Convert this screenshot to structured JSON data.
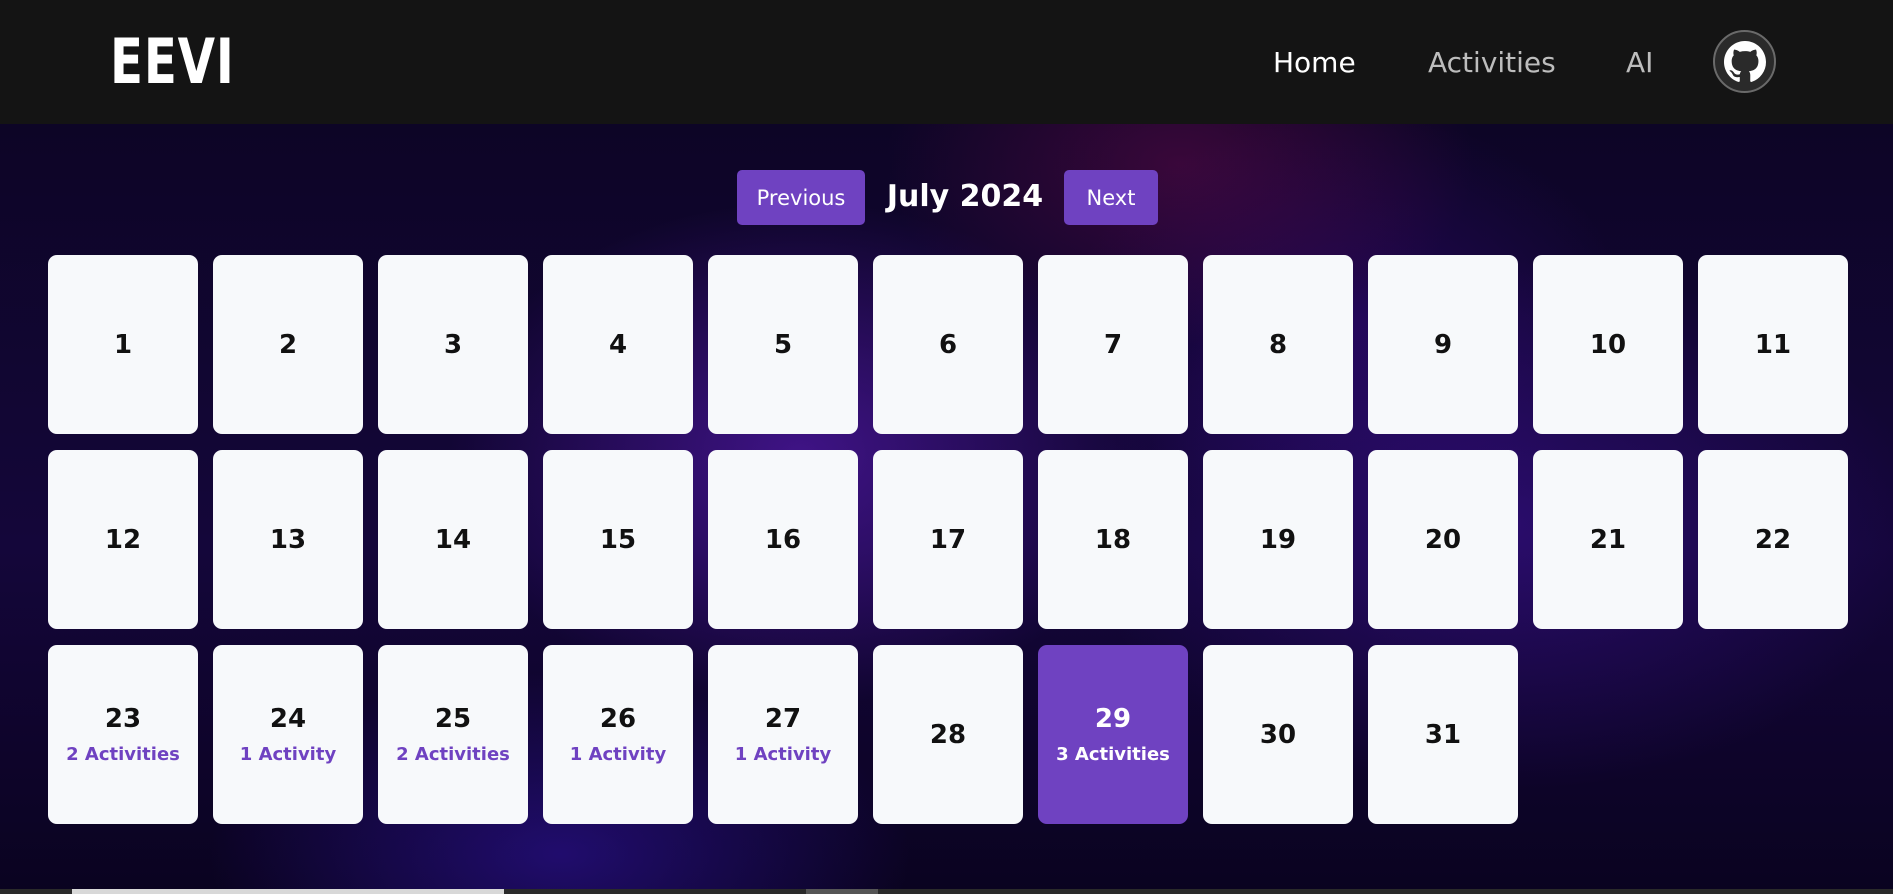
{
  "header": {
    "logo": "EEVI",
    "nav": {
      "home": "Home",
      "activities": "Activities",
      "ai": "AI"
    },
    "github_icon": "github-icon"
  },
  "calendar": {
    "prev_label": "Previous",
    "next_label": "Next",
    "month_title": "July 2024",
    "selected_day": "29",
    "days": [
      {
        "day": "1",
        "activities": ""
      },
      {
        "day": "2",
        "activities": ""
      },
      {
        "day": "3",
        "activities": ""
      },
      {
        "day": "4",
        "activities": ""
      },
      {
        "day": "5",
        "activities": ""
      },
      {
        "day": "6",
        "activities": ""
      },
      {
        "day": "7",
        "activities": ""
      },
      {
        "day": "8",
        "activities": ""
      },
      {
        "day": "9",
        "activities": ""
      },
      {
        "day": "10",
        "activities": ""
      },
      {
        "day": "11",
        "activities": ""
      },
      {
        "day": "12",
        "activities": ""
      },
      {
        "day": "13",
        "activities": ""
      },
      {
        "day": "14",
        "activities": ""
      },
      {
        "day": "15",
        "activities": ""
      },
      {
        "day": "16",
        "activities": ""
      },
      {
        "day": "17",
        "activities": ""
      },
      {
        "day": "18",
        "activities": ""
      },
      {
        "day": "19",
        "activities": ""
      },
      {
        "day": "20",
        "activities": ""
      },
      {
        "day": "21",
        "activities": ""
      },
      {
        "day": "22",
        "activities": ""
      },
      {
        "day": "23",
        "activities": "2 Activities"
      },
      {
        "day": "24",
        "activities": "1 Activity"
      },
      {
        "day": "25",
        "activities": "2 Activities"
      },
      {
        "day": "26",
        "activities": "1 Activity"
      },
      {
        "day": "27",
        "activities": "1 Activity"
      },
      {
        "day": "28",
        "activities": ""
      },
      {
        "day": "29",
        "activities": "3 Activities"
      },
      {
        "day": "30",
        "activities": ""
      },
      {
        "day": "31",
        "activities": ""
      }
    ]
  },
  "colors": {
    "accent": "#6f42c1",
    "navbar": "#141414",
    "card": "#f7f9fb"
  }
}
